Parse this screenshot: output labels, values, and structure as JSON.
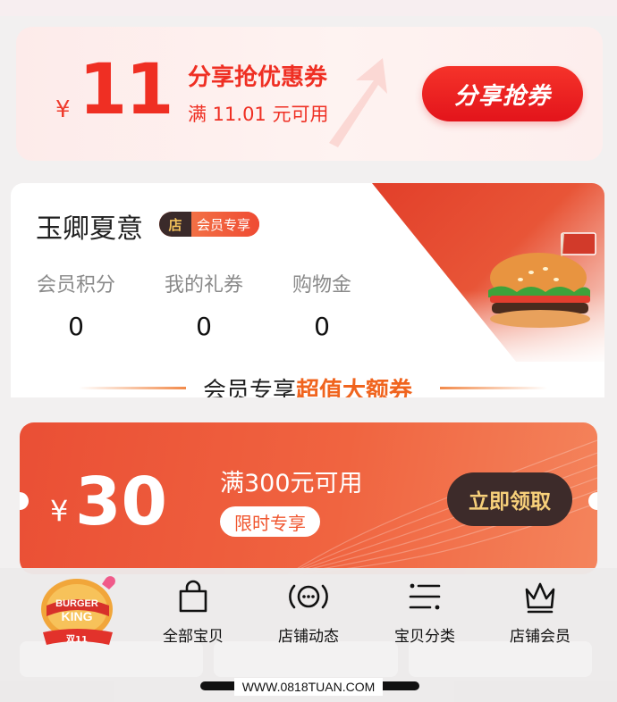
{
  "share_coupon": {
    "currency": "¥",
    "amount": "11",
    "title": "分享抢优惠券",
    "condition": "满 11.01 元可用",
    "button": "分享抢券"
  },
  "member": {
    "store_name": "玉卿夏意",
    "badge_shop": "店",
    "badge_label": "会员专享",
    "stats": [
      {
        "label": "会员积分",
        "value": "0"
      },
      {
        "label": "我的礼券",
        "value": "0"
      },
      {
        "label": "购物金",
        "value": "0"
      }
    ],
    "section_title_prefix": "会员专享",
    "section_title_highlight": "超值大额券"
  },
  "big_coupon": {
    "currency": "¥",
    "amount": "30",
    "condition": "满300元可用",
    "tag": "限时专享",
    "button": "立即领取"
  },
  "bottom_nav": {
    "logo_text_1": "BURGER",
    "logo_text_2": "KING",
    "logo_tag": "双11",
    "items": [
      {
        "label": "全部宝贝",
        "icon": "bag-icon"
      },
      {
        "label": "店铺动态",
        "icon": "broadcast-icon"
      },
      {
        "label": "宝贝分类",
        "icon": "list-icon"
      },
      {
        "label": "店铺会员",
        "icon": "crown-icon"
      }
    ]
  },
  "watermark": "WWW.0818TUAN.COM",
  "colors": {
    "accent_red": "#ef2f23",
    "coupon_orange": "#ea4f35",
    "highlight_orange": "#f0641e",
    "dark_button": "#3d2b2a"
  }
}
